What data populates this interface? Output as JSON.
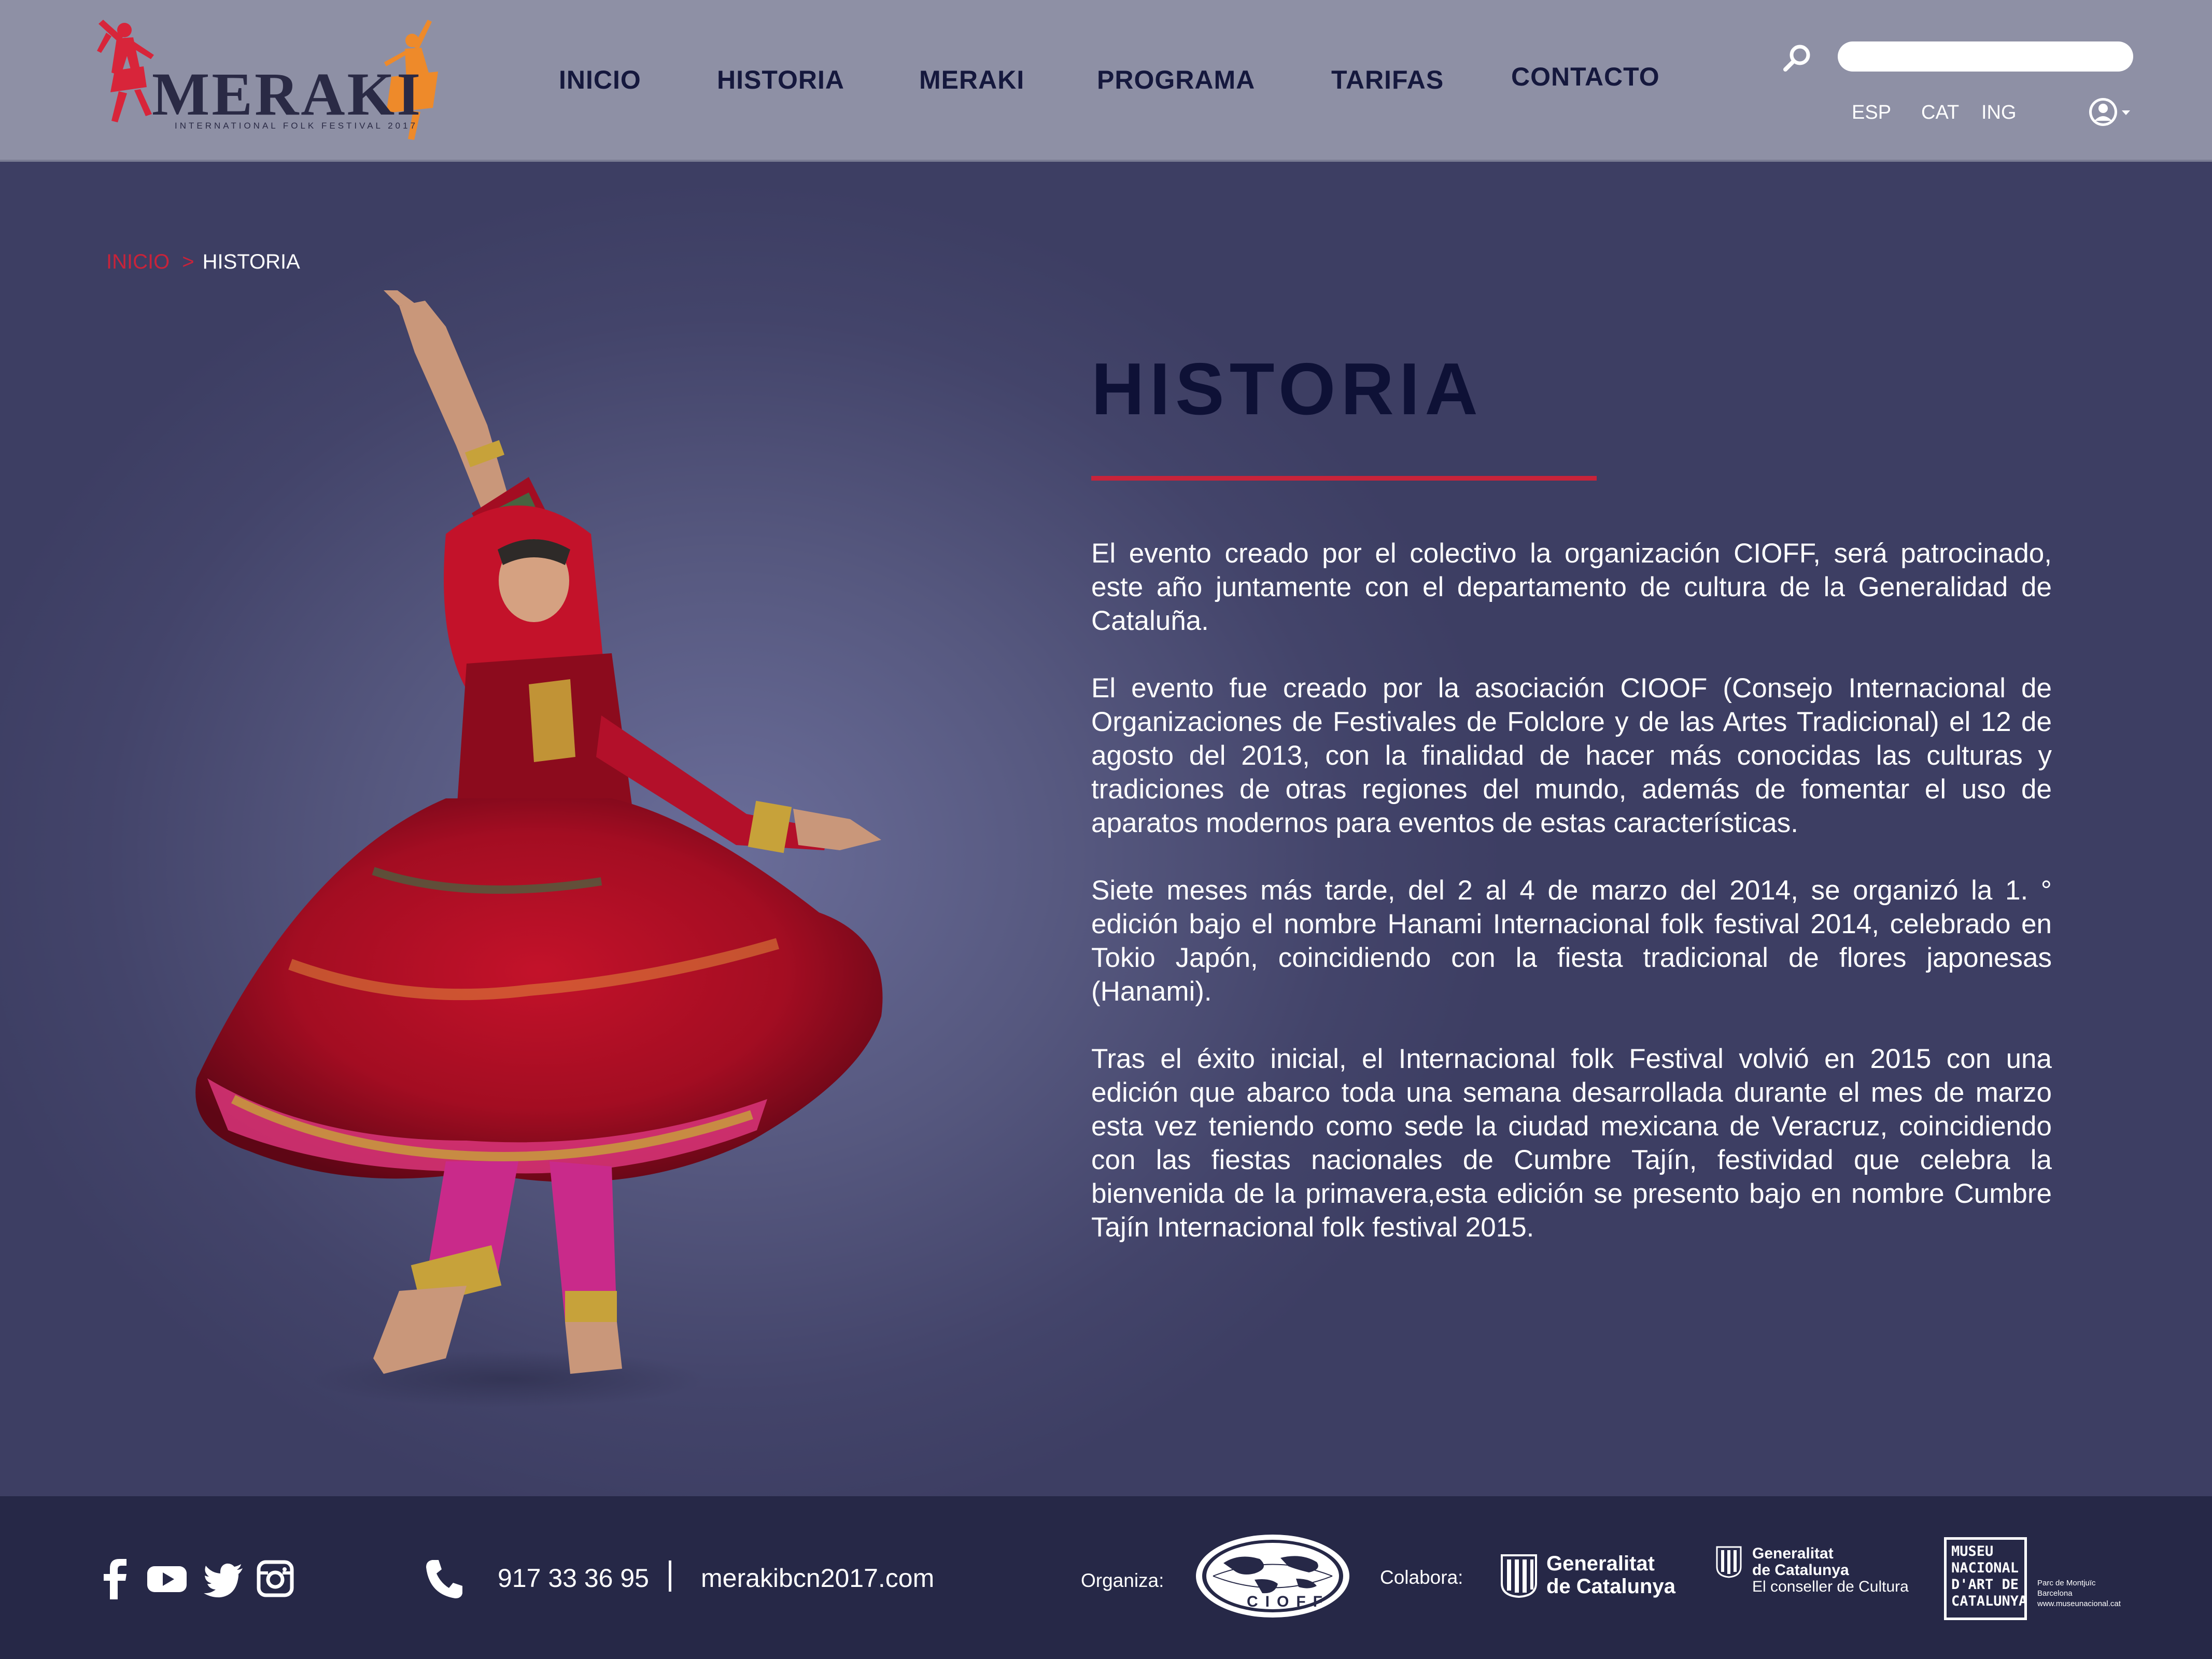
{
  "header": {
    "logo": {
      "wordmark": "MERAKI",
      "tagline": "INTERNATIONAL FOLK FESTIVAL 2017"
    },
    "nav": [
      {
        "label": "INICIO"
      },
      {
        "label": "HISTORIA"
      },
      {
        "label": "MERAKI"
      },
      {
        "label": "PROGRAMA"
      },
      {
        "label": "TARIFAS"
      },
      {
        "label": "CONTACTO"
      }
    ],
    "search": {
      "placeholder": "",
      "icon": "search-icon"
    },
    "languages": [
      "ESP",
      "CAT",
      "ING"
    ],
    "user_icon": "user-avatar-icon"
  },
  "breadcrumb": {
    "home": "INICIO",
    "separator": ">",
    "current": "HISTORIA"
  },
  "main": {
    "title": "HISTORIA",
    "paragraphs": [
      "El evento creado por el colectivo la organización CIOFF, será patrocinado, este año juntamente con el departamento de cultura de la Generalidad de Cataluña.",
      "El evento fue creado por la asociación CIOOF (Consejo Internacional de Organizaciones de Festivales de Folclore y de las Artes Tradicional) el 12 de agosto del 2013, con la finalidad de hacer más conocidas las culturas y tradiciones de otras regiones del mundo, además de fomentar el uso de aparatos modernos para eventos de estas características.",
      "Siete meses más tarde, del 2 al 4 de marzo del 2014, se organizó la 1. ° edición bajo el nombre Hanami Internacional folk festival 2014, celebrado en Tokio Japón, coincidiendo con la fiesta tradicional de flores japonesas (Hanami).",
      "Tras el éxito inicial, el Internacional folk Festival volvió en 2015 con una edición que abarco toda una semana desarrollada durante el mes de marzo esta vez teniendo como sede la ciudad mexicana de Veracruz, coincidiendo con las fiestas nacionales de Cumbre Tajín, festividad que celebra la bienvenida de la primavera,esta edición se presento bajo en nombre Cumbre Tajín Internacional folk festival 2015."
    ]
  },
  "footer": {
    "social": [
      "facebook-icon",
      "youtube-icon",
      "twitter-icon",
      "instagram-icon"
    ],
    "phone": "917 33 36 95",
    "website": "merakibcn2017.com",
    "organiza_label": "Organiza:",
    "cioff_logo_text": "CIOFF",
    "colabora_label": "Colabora:",
    "gencat_logo": {
      "line1": "Generalitat",
      "line2": "de Catalunya"
    },
    "conseller_logo": {
      "line1": "Generalitat",
      "line2": "de Catalunya",
      "line3": "El conseller de Cultura"
    },
    "museu_logo": {
      "line1": "MUSEU",
      "line2": "NACIONAL",
      "line3": "D'ART DE",
      "line4": "CATALUNYA",
      "side1": "Parc de Montjuïc",
      "side2": "Barcelona",
      "side3": "www.museunacional.cat"
    }
  },
  "colors": {
    "header_bg": "#8e90a5",
    "page_bg": "#4d4f76",
    "footer_bg": "#262847",
    "accent_red": "#c8233a",
    "title_navy": "#0e1136",
    "logo_orange": "#ee8a2a",
    "logo_red": "#d8253a"
  }
}
